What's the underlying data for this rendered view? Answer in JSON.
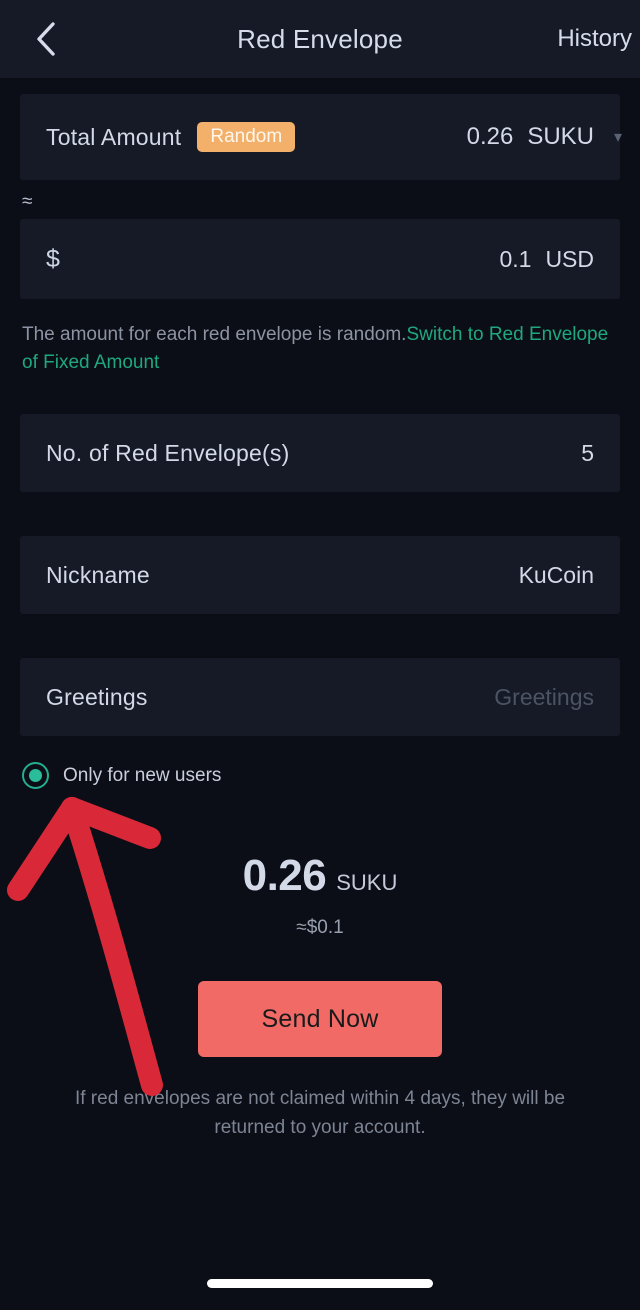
{
  "header": {
    "back_icon": "chevron-left-icon",
    "title": "Red Envelope",
    "history_label": "History"
  },
  "total_amount": {
    "label": "Total Amount",
    "badge": "Random",
    "value": "0.26",
    "currency": "SUKU",
    "caret_icon": "chevron-down-icon"
  },
  "usd": {
    "approx_symbol": "≈",
    "dollar_symbol": "$",
    "value": "0.1",
    "currency": "USD"
  },
  "hint": {
    "text": "The amount for each red envelope is random.",
    "link": "Switch to Red Envelope of Fixed Amount"
  },
  "count": {
    "label": "No. of Red Envelope(s)",
    "value": "5"
  },
  "nickname": {
    "label": "Nickname",
    "value": "KuCoin"
  },
  "greetings": {
    "label": "Greetings",
    "placeholder": "Greetings",
    "value": ""
  },
  "new_users": {
    "label": "Only for new users",
    "selected": true
  },
  "summary": {
    "amount": "0.26",
    "currency": "SUKU",
    "usd": "≈$0.1"
  },
  "send": {
    "label": "Send Now"
  },
  "footer": {
    "note": "If red envelopes are not claimed within 4 days, they will be returned to your account."
  },
  "colors": {
    "page_bg": "#0B0E16",
    "card_bg": "#161A26",
    "header_bg": "#151A26",
    "badge_orange": "#F2B06B",
    "link_green": "#1FA87F",
    "radio_green": "#2BBD9A",
    "send_button": "#F26A66",
    "annotation_red": "#D92938",
    "text_primary": "#D3D9E7",
    "text_muted": "#7D8494"
  }
}
